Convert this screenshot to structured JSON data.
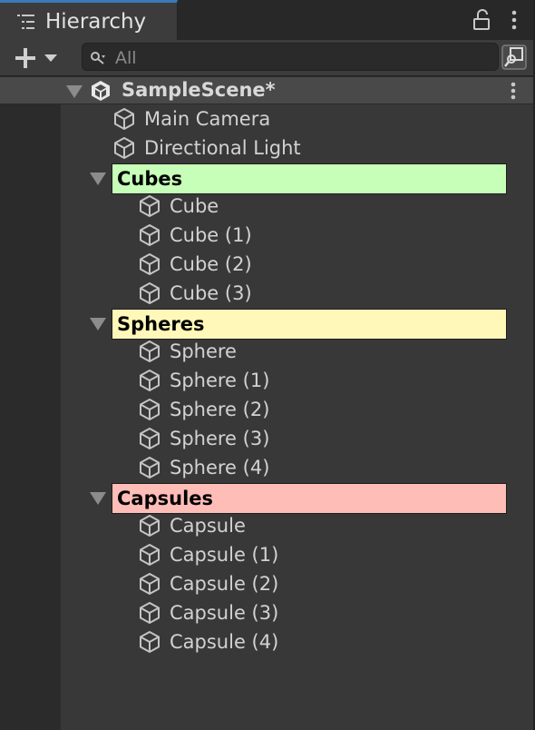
{
  "window": {
    "tab_title": "Hierarchy",
    "tab_icon": "list-icon",
    "lock_icon": "lock-icon",
    "menu_icon": "kebab-menu-icon"
  },
  "toolbar": {
    "create_icon": "plus-icon",
    "dropdown_icon": "dropdown-arrow-icon",
    "search_placeholder": "All",
    "search_value": "",
    "search_icon": "search-icon",
    "search_mode_icon": "search-window-icon"
  },
  "scene": {
    "name": "SampleScene*",
    "icon": "unity-scene-icon",
    "expanded": true
  },
  "colors": {
    "cubes_header": "#c7ffb9",
    "spheres_header": "#fff8b9",
    "capsules_header": "#ffbdb8",
    "tab_accent": "#3a79bb"
  },
  "items": {
    "main_camera": "Main Camera",
    "directional_light": "Directional Light"
  },
  "groups": [
    {
      "label": "Cubes",
      "expanded": true,
      "children": [
        "Cube",
        "Cube (1)",
        "Cube (2)",
        "Cube (3)"
      ]
    },
    {
      "label": "Spheres",
      "expanded": true,
      "children": [
        "Sphere",
        "Sphere (1)",
        "Sphere (2)",
        "Sphere (3)",
        "Sphere (4)"
      ]
    },
    {
      "label": "Capsules",
      "expanded": true,
      "children": [
        "Capsule",
        "Capsule (1)",
        "Capsule (2)",
        "Capsule (3)",
        "Capsule (4)"
      ]
    }
  ]
}
